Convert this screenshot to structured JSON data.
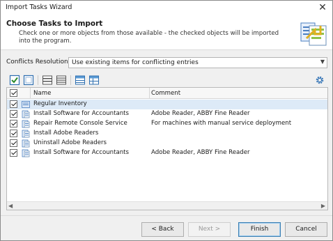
{
  "window": {
    "title": "Import Tasks Wizard"
  },
  "header": {
    "title": "Choose Tasks to Import",
    "description": "Check one or more objects from those available - the checked objects will be imported into the program."
  },
  "conflicts": {
    "label": "Conflicts Resolution:",
    "selected": "Use existing items for conflicting entries"
  },
  "toolbar": {
    "icons": [
      "check-all-icon",
      "uncheck-all-icon",
      "expand-rows-icon",
      "collapse-rows-icon",
      "column-layout-icon",
      "grid-layout-icon",
      "settings-gear-icon"
    ]
  },
  "grid": {
    "columns": {
      "name": "Name",
      "comment": "Comment"
    },
    "rows": [
      {
        "name": "Regular Inventory",
        "comment": "",
        "checked": true,
        "selected": true
      },
      {
        "name": "Install Software for Accountants",
        "comment": "Adobe Reader, ABBY Fine Reader",
        "checked": true,
        "selected": false
      },
      {
        "name": "Repair Remote Console Service",
        "comment": "For machines with manual service deployment",
        "checked": true,
        "selected": false
      },
      {
        "name": "Install Adobe Readers",
        "comment": "",
        "checked": true,
        "selected": false
      },
      {
        "name": "Uninstall Adobe Readers",
        "comment": "",
        "checked": true,
        "selected": false
      },
      {
        "name": "Install Software for Accountants",
        "comment": "Adobe Reader, ABBY Fine Reader",
        "checked": true,
        "selected": false
      }
    ]
  },
  "buttons": {
    "back": "< Back",
    "next": "Next >",
    "finish": "Finish",
    "cancel": "Cancel"
  },
  "colors": {
    "selected_row": "#ddeaf7",
    "default_button_border": "#3c7fb1"
  }
}
